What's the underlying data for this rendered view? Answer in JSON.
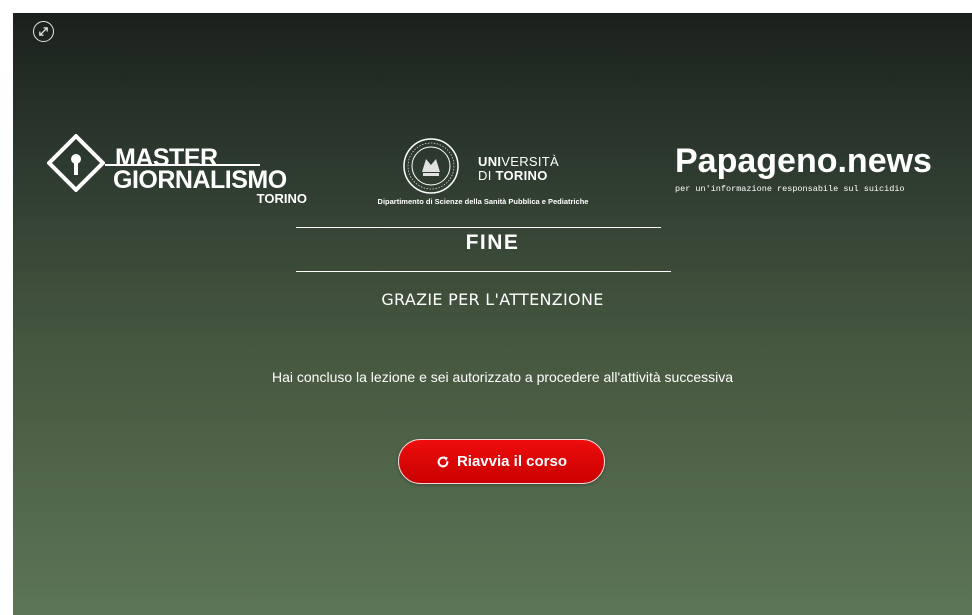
{
  "player": {
    "expand_icon": "expand-arrows-icon"
  },
  "logos": {
    "master": {
      "line1": "MASTER",
      "line2": "GIORNALISMO",
      "line3": "TORINO"
    },
    "unito": {
      "name_prefix1": "UNI",
      "name_rest1": "VERSITÀ",
      "name_prefix2": "DI ",
      "name_rest2": "TORINO",
      "department": "Dipartimento di Scienze della Sanità Pubblica e Pediatriche"
    },
    "papageno": {
      "title": "Papageno.news",
      "subtitle": "per un'informazione responsabile sul suicidio"
    }
  },
  "content": {
    "title": "FINE",
    "subtitle": "GRAZIE PER L'ATTENZIONE",
    "message": "Hai concluso la lezione e sei autorizzato a procedere all'attività successiva"
  },
  "actions": {
    "restart_label": "Riavvia il corso",
    "restart_icon": "restart-arrow-icon"
  },
  "colors": {
    "button_red": "#e00000",
    "background_top": "#1b201c",
    "background_bottom": "#5d7557"
  }
}
